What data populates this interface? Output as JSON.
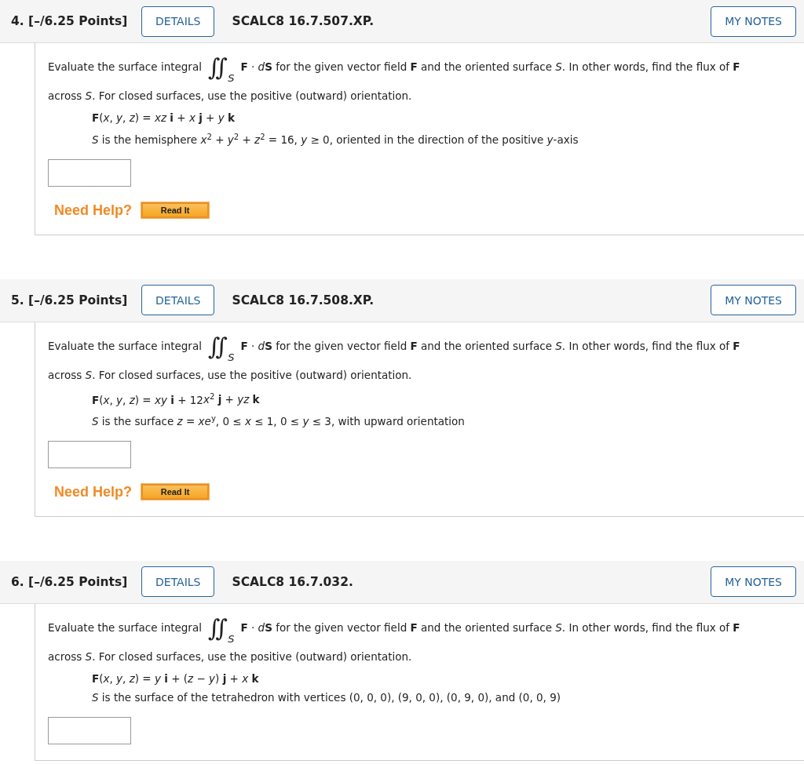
{
  "questions": [
    {
      "number": "4.",
      "points": "[–/6.25 Points]",
      "details_button": "DETAILS",
      "code": "SCALC8 16.7.507.XP.",
      "notes_button": "MY NOTES",
      "statement_before": "Evaluate the surface integral",
      "integral": "∫∫",
      "integral_subscript": "S",
      "statement_after": [
        "**F** · ",
        "*d*",
        "**S**  for the given vector field **F** and the oriented surface *S*. In other words, find the flux of **F**"
      ],
      "statement_line2": "across *S*. For closed surfaces, use the positive (outward) orientation.",
      "field": [
        "**F**(*x*, *y*, *z*) = *xz* **i** + *x* **j** + *y* **k**"
      ],
      "surface": [
        "*S* is the hemisphere  *x*$^{2}$ + *y*$^{2}$ + *z*$^{2}$ = 16, *y* ≥ 0,  oriented in the direction of the positive *y*-axis"
      ],
      "help_label": "Need Help?",
      "help_button": "Read It"
    },
    {
      "number": "5.",
      "points": "[–/6.25 Points]",
      "details_button": "DETAILS",
      "code": "SCALC8 16.7.508.XP.",
      "notes_button": "MY NOTES",
      "statement_before": "Evaluate the surface integral",
      "integral": "∫∫",
      "integral_subscript": "S",
      "statement_after": [
        "**F** · ",
        "*d*",
        "**S**  for the given vector field **F** and the oriented surface *S*. In other words, find the flux of **F**"
      ],
      "statement_line2": "across *S*. For closed surfaces, use the positive (outward) orientation.",
      "field": [
        "**F**(*x*, *y*, *z*) = *xy* **i** + 12",
        "*x*$^{2}$ **j** + *yz* **k**"
      ],
      "surface": [
        "*S* is the surface  *z* = *xe*$^{y}$, 0 ≤ *x* ≤ 1, 0 ≤ *y* ≤ 3,  with upward orientation"
      ],
      "help_label": "Need Help?",
      "help_button": "Read It"
    },
    {
      "number": "6.",
      "points": "[–/6.25 Points]",
      "details_button": "DETAILS",
      "code": "SCALC8 16.7.032.",
      "notes_button": "MY NOTES",
      "statement_before": "Evaluate the surface integral",
      "integral": "∫∫",
      "integral_subscript": "S",
      "statement_after": [
        "**F** · ",
        "*d*",
        "**S**  for the given vector field **F** and the oriented surface *S*. In other words, find the flux of **F**"
      ],
      "statement_line2": "across *S*. For closed surfaces, use the positive (outward) orientation.",
      "field": [
        "**F**(*x*, *y*, *z*) = *y* **i** + (*z* − *y*) **j** + *x* **k**"
      ],
      "surface": [
        "*S* is the surface of the tetrahedron with vertices (0, 0, 0), (9, 0, 0), (0, 9, 0), and (0, 0, 9)"
      ]
    }
  ]
}
